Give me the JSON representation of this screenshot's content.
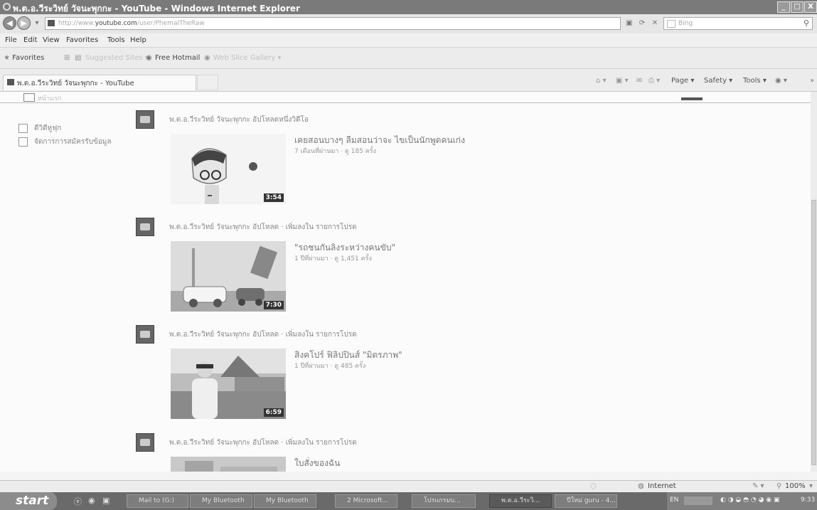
{
  "window": {
    "title": "พ.ต.อ.วีระวิทย์ วัจนะพุกกะ - YouTube - Windows Internet Explorer",
    "controls": [
      "_",
      "□",
      "X"
    ]
  },
  "address": {
    "url_prefix": "http://www.",
    "url_domain": "youtube.com",
    "url_suffix": "/user/PhemalTheRaw",
    "search_placeholder": "Bing"
  },
  "menu": [
    "File",
    "Edit",
    "View",
    "Favorites",
    "Tools",
    "Help"
  ],
  "favorites_bar": {
    "favorites_label": "Favorites",
    "suggested_sites": "Suggested Sites ▾",
    "free_hotmail": "Free Hotmail",
    "web_slice": "Web Slice Gallery ▾"
  },
  "tab": {
    "title": "พ.ต.อ.วีระวิทย์ วัจนะพุกกะ - YouTube"
  },
  "command_bar": {
    "page": "Page ▾",
    "safety": "Safety ▾",
    "tools": "Tools ▾"
  },
  "sidebar": {
    "home_label": "หน้าแรก",
    "items": [
      {
        "label": "ดีวิดีหูฟุก"
      },
      {
        "label": "จัดการการสมัครรับข้อมูล"
      }
    ]
  },
  "feed": [
    {
      "meta": "พ.ต.อ.วีระวิทย์ วัจนะพุกกะ อัปโหลดหนึ่งวิดีโอ",
      "title": "เคยสอนบางๆ ลืมสอนว่าจะ ไขเป็นนักพูดคนเก่ง",
      "stats": "7 เดือนที่ผ่านมา · ดู 185 ครั้ง",
      "duration": "3:54"
    },
    {
      "meta": "พ.ต.อ.วีระวิทย์ วัจนะพุกกะ อัปโหลด · เพิ่มลงใน รายการโปรด",
      "title": "\"รถชนกันลิงระหว่างคนขับ\"",
      "stats": "1 ปีที่ผ่านมา · ดู 1,451 ครั้ง",
      "duration": "7:30"
    },
    {
      "meta": "พ.ต.อ.วีระวิทย์ วัจนะพุกกะ อัปโหลด · เพิ่มลงใน รายการโปรด",
      "title": "สิงคโปร์ ฟิลิปปินส์ \"มิตรภาพ\"",
      "stats": "1 ปีที่ผ่านมา · ดู 485 ครั้ง",
      "duration": "6:59"
    },
    {
      "meta": "พ.ต.อ.วีระวิทย์ วัจนะพุกกะ อัปโหลด · เพิ่มลงใน รายการโปรด",
      "title": "ใบสั่งของฉัน",
      "stats": "",
      "duration": ""
    }
  ],
  "status": {
    "zone": "Internet",
    "zoom": "100%"
  },
  "taskbar": {
    "start": "start",
    "tasks": [
      {
        "label": "Mail to (G:)"
      },
      {
        "label": "My Bluetooth"
      },
      {
        "label": "My Bluetooth"
      },
      {
        "label": "2 Microsoft..."
      },
      {
        "label": "โปรแกรมบ..."
      },
      {
        "label": "พ.ต.อ.วีระวิ..."
      },
      {
        "label": "ปีใหม่ guru - 4..."
      }
    ],
    "lang": "EN",
    "clock": "9:33"
  }
}
